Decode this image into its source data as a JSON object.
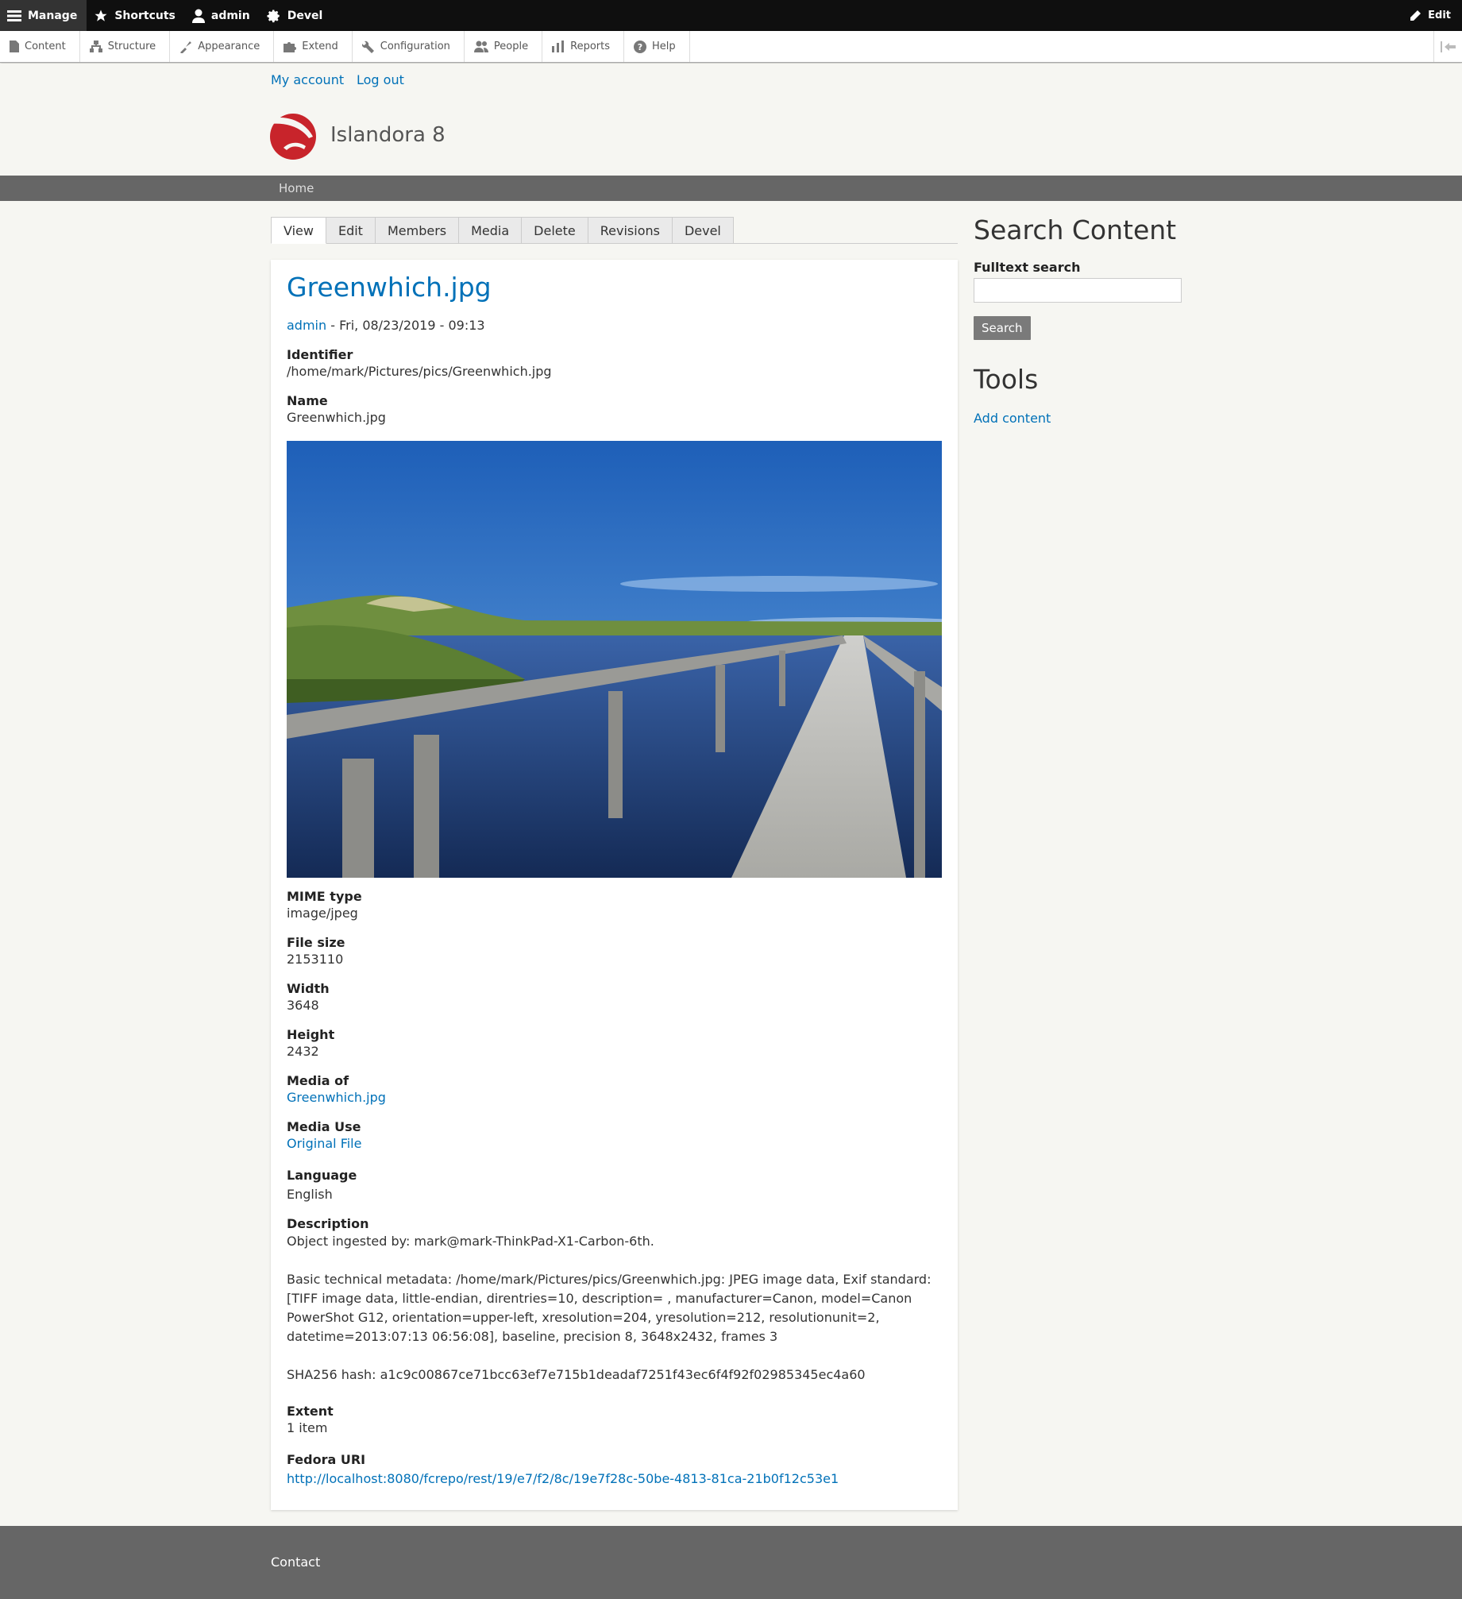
{
  "toolbar": {
    "manage": "Manage",
    "shortcuts": "Shortcuts",
    "user": "admin",
    "devel": "Devel",
    "edit": "Edit"
  },
  "tray": {
    "items": [
      "Content",
      "Structure",
      "Appearance",
      "Extend",
      "Configuration",
      "People",
      "Reports",
      "Help"
    ]
  },
  "secondary_menu": {
    "my_account": "My account",
    "log_out": "Log out"
  },
  "site": {
    "name": "Islandora 8",
    "logo_color": "#c8242b"
  },
  "breadcrumb": {
    "home": "Home"
  },
  "tabs": [
    "View",
    "Edit",
    "Members",
    "Media",
    "Delete",
    "Revisions",
    "Devel"
  ],
  "node": {
    "title": "Greenwhich.jpg",
    "author": "admin",
    "date": " - Fri, 08/23/2019 - 09:13",
    "fields": {
      "identifier_label": "Identifier",
      "identifier": "/home/mark/Pictures/pics/Greenwhich.jpg",
      "name_label": "Name",
      "name": "Greenwhich.jpg",
      "mime_label": "MIME type",
      "mime": "image/jpeg",
      "filesize_label": "File size",
      "filesize": "2153110",
      "width_label": "Width",
      "width": "3648",
      "height_label": "Height",
      "height": "2432",
      "media_of_label": "Media of",
      "media_of": "Greenwhich.jpg",
      "media_use_label": "Media Use",
      "media_use": "Original File",
      "language_label": "Language",
      "language": "English",
      "description_label": "Description",
      "description_1": "Object ingested by: mark@mark-ThinkPad-X1-Carbon-6th.",
      "description_2": "Basic technical metadata: /home/mark/Pictures/pics/Greenwhich.jpg: JPEG image data, Exif standard: [TIFF image data, little-endian, direntries=10, description= , manufacturer=Canon, model=Canon PowerShot G12, orientation=upper-left, xresolution=204, yresolution=212, resolutionunit=2, datetime=2013:07:13 06:56:08], baseline, precision 8, 3648x2432, frames 3",
      "description_3": "SHA256 hash: a1c9c00867ce71bcc63ef7e715b1deadaf7251f43ec6f4f92f02985345ec4a60",
      "extent_label": "Extent",
      "extent": "1 item",
      "fedora_label": "Fedora URI",
      "fedora": "http://localhost:8080/fcrepo/rest/19/e7/f2/8c/19e7f28c-50be-4813-81ca-21b0f12c53e1"
    }
  },
  "sidebar": {
    "search_title": "Search Content",
    "search_label": "Fulltext search",
    "search_value": "",
    "search_button": "Search",
    "tools_title": "Tools",
    "add_content": "Add content"
  },
  "footer": {
    "contact": "Contact"
  }
}
